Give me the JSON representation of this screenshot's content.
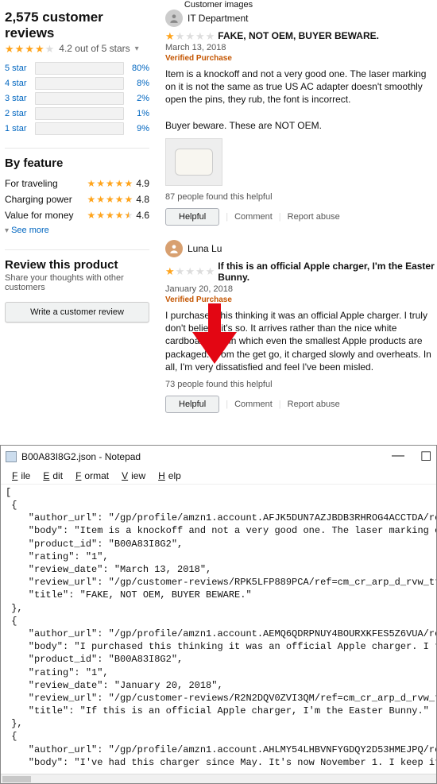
{
  "customer_images_header": "Customer images",
  "summary": {
    "count_text": "2,575 customer reviews",
    "avg_text": "4.2 out of 5 stars",
    "dist": [
      {
        "label": "5 star",
        "pct": 80
      },
      {
        "label": "4 star",
        "pct": 8
      },
      {
        "label": "3 star",
        "pct": 2
      },
      {
        "label": "2 star",
        "pct": 1
      },
      {
        "label": "1 star",
        "pct": 9
      }
    ]
  },
  "by_feature": {
    "title": "By feature",
    "rows": [
      {
        "name": "For traveling",
        "score": "4.9",
        "fill": 5
      },
      {
        "name": "Charging power",
        "score": "4.8",
        "fill": 5
      },
      {
        "name": "Value for money",
        "score": "4.6",
        "fill": 4.5
      }
    ],
    "see_more": "See more"
  },
  "review_this": {
    "title": "Review this product",
    "subtitle": "Share your thoughts with other customers",
    "button": "Write a customer review"
  },
  "reviews": [
    {
      "author": "IT Department",
      "avatar_icon": "default",
      "rating": 1,
      "title": "FAKE, NOT OEM, BUYER BEWARE.",
      "date": "March 13, 2018",
      "verified": "Verified Purchase",
      "body": "Item is a knockoff and not a very good one. The laser marking on it is not the same as true US AC adapter doesn't smoothly open the pins, they rub, the font is incorrect.\n\nBuyer beware. These are NOT OEM.",
      "has_image": true,
      "helpful_count": "87 people found this helpful"
    },
    {
      "author": "Luna Lu",
      "avatar_icon": "person",
      "rating": 1,
      "title": "If this is an official Apple charger, I'm the Easter Bunny.",
      "date": "January 20, 2018",
      "verified": "Verified Purchase",
      "body": "I purchased this thinking it was an official Apple charger. I truly don't believe it's so. It arrives rather than the nice white cardboard box in which even the smallest Apple products are packaged. From the get go, it charged slowly and overheats. In all, I'm very dissatisfied and feel I've been misled.",
      "has_image": false,
      "helpful_count": "73 people found this helpful"
    }
  ],
  "actions": {
    "helpful": "Helpful",
    "comment": "Comment",
    "report": "Report abuse"
  },
  "notepad": {
    "title": "B00A83I8G2.json - Notepad",
    "menu": [
      "File",
      "Edit",
      "Format",
      "View",
      "Help"
    ],
    "content": "[\n {\n    \"author_url\": \"/gp/profile/amzn1.account.AFJK5DUN7AZJBDB3RHROG4ACCTDA/ref\n    \"body\": \"Item is a knockoff and not a very good one. The laser marking on\n    \"product_id\": \"B00A83I8G2\",\n    \"rating\": \"1\",\n    \"review_date\": \"March 13, 2018\",\n    \"review_url\": \"/gp/customer-reviews/RPK5LFP889PCA/ref=cm_cr_arp_d_rvw_ttl\n    \"title\": \"FAKE, NOT OEM, BUYER BEWARE.\"\n },\n {\n    \"author_url\": \"/gp/profile/amzn1.account.AEMQ6QDRPNUY4BOURXKFES5Z6VUA/ref\n    \"body\": \"I purchased this thinking it was an official Apple charger. I tr\n    \"product_id\": \"B00A83I8G2\",\n    \"rating\": \"1\",\n    \"review_date\": \"January 20, 2018\",\n    \"review_url\": \"/gp/customer-reviews/R2N2DQV0ZVI3QM/ref=cm_cr_arp_d_rvw_tt\n    \"title\": \"If this is an official Apple charger, I'm the Easter Bunny.\"\n },\n {\n    \"author_url\": \"/gp/profile/amzn1.account.AHLMY54LHBVNFYGDQY2D53HMEJPQ/ref\n    \"body\": \"I've had this charger since May. It's now November 1. I keep it"
  }
}
